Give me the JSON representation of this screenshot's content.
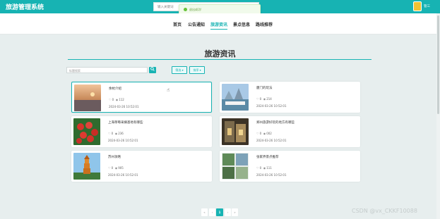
{
  "app": {
    "title": "旅游管理系统"
  },
  "header": {
    "search_placeholder": "输入关键词",
    "user": "管三"
  },
  "toast": {
    "message": "退出成功!"
  },
  "nav": {
    "items": [
      "首页",
      "公告通知",
      "旅游资讯",
      "景点信息",
      "路线推荐"
    ]
  },
  "page": {
    "title": "旅游资讯"
  },
  "toolbar": {
    "search_placeholder": "标题搜索",
    "search_icon": "search-icon",
    "filter_label": "筛选",
    "sort_label": "排序"
  },
  "cards": [
    {
      "title": "余杭介绍",
      "likes": "0",
      "views": "112",
      "date": "2024-03-26 10:52:01"
    },
    {
      "title": "厦门的玩法",
      "likes": "0",
      "views": "214",
      "date": "2024-03-26 10:52:01"
    },
    {
      "title": "上海草莓采摘基地有哪些",
      "likes": "0",
      "views": "236",
      "date": "2024-03-26 10:52:01"
    },
    {
      "title": "郑州旅游好玩的地方有哪些",
      "likes": "0",
      "views": "002",
      "date": "2024-03-26 10:52:01"
    },
    {
      "title": "苏州攻略",
      "likes": "0",
      "views": "905",
      "date": "2024-03-26 10:52:01"
    },
    {
      "title": "张家界景点推荐",
      "likes": "0",
      "views": "111",
      "date": "2024-03-26 10:52:01"
    }
  ],
  "pagination": {
    "first": "«",
    "prev": "‹",
    "current": "1",
    "next": "›",
    "last": "»"
  },
  "watermark": "CSDN @vx_CKKF10088",
  "colors": {
    "accent": "#17b3b3",
    "background": "#e7eeee"
  }
}
